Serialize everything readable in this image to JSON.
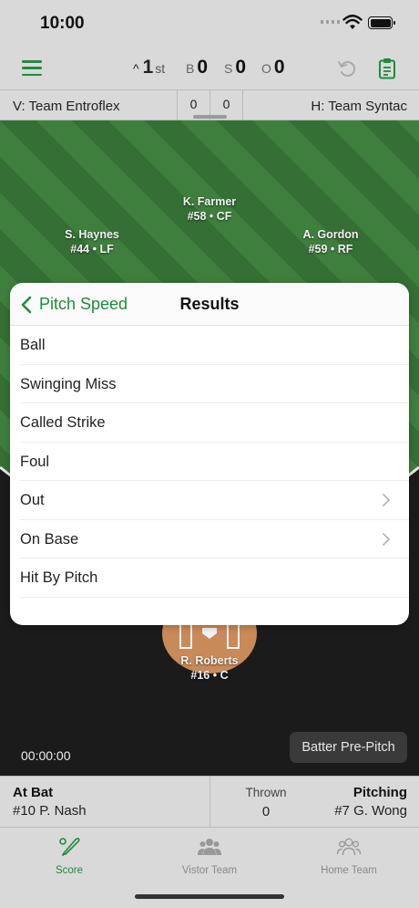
{
  "status": {
    "time": "10:00"
  },
  "toolbar": {
    "inning_arrow": "^",
    "inning_num": "1",
    "inning_suffix": "st",
    "balls_label": "B",
    "balls": "0",
    "strikes_label": "S",
    "strikes": "0",
    "outs_label": "O",
    "outs": "0"
  },
  "teams": {
    "visitor": "V: Team Entroflex",
    "home": "H: Team Syntac",
    "visitor_score": "0",
    "home_score": "0"
  },
  "field": {
    "players": [
      {
        "name": "K. Farmer",
        "detail": "#58 • CF"
      },
      {
        "name": "S. Haynes",
        "detail": "#44 • LF"
      },
      {
        "name": "A. Gordon",
        "detail": "#59 • RF"
      },
      {
        "name": "R. Roberts",
        "detail": "#16 • C"
      }
    ],
    "timer": "00:00:00",
    "pre_pitch_button": "Batter Pre-Pitch"
  },
  "modal": {
    "back_label": "Pitch Speed",
    "title": "Results",
    "options": [
      {
        "label": "Ball",
        "chevron": false
      },
      {
        "label": "Swinging Miss",
        "chevron": false
      },
      {
        "label": "Called Strike",
        "chevron": false
      },
      {
        "label": "Foul",
        "chevron": false
      },
      {
        "label": "Out",
        "chevron": true
      },
      {
        "label": "On Base",
        "chevron": true
      },
      {
        "label": "Hit By Pitch",
        "chevron": false
      }
    ]
  },
  "info": {
    "at_bat_title": "At Bat",
    "at_bat_value": "#10 P. Nash",
    "thrown_title": "Thrown",
    "thrown_value": "0",
    "pitching_title": "Pitching",
    "pitching_value": "#7 G. Wong"
  },
  "tabs": [
    {
      "label": "Score",
      "icon": "bat-ball-icon",
      "active": true
    },
    {
      "label": "Vistor Team",
      "icon": "team-group-icon",
      "active": false
    },
    {
      "label": "Home Team",
      "icon": "team-group-outline-icon",
      "active": false
    }
  ],
  "colors": {
    "accent": "#1e8c3a",
    "field_green": "#3c7b3b",
    "infield_dirt": "#c98a5a"
  }
}
